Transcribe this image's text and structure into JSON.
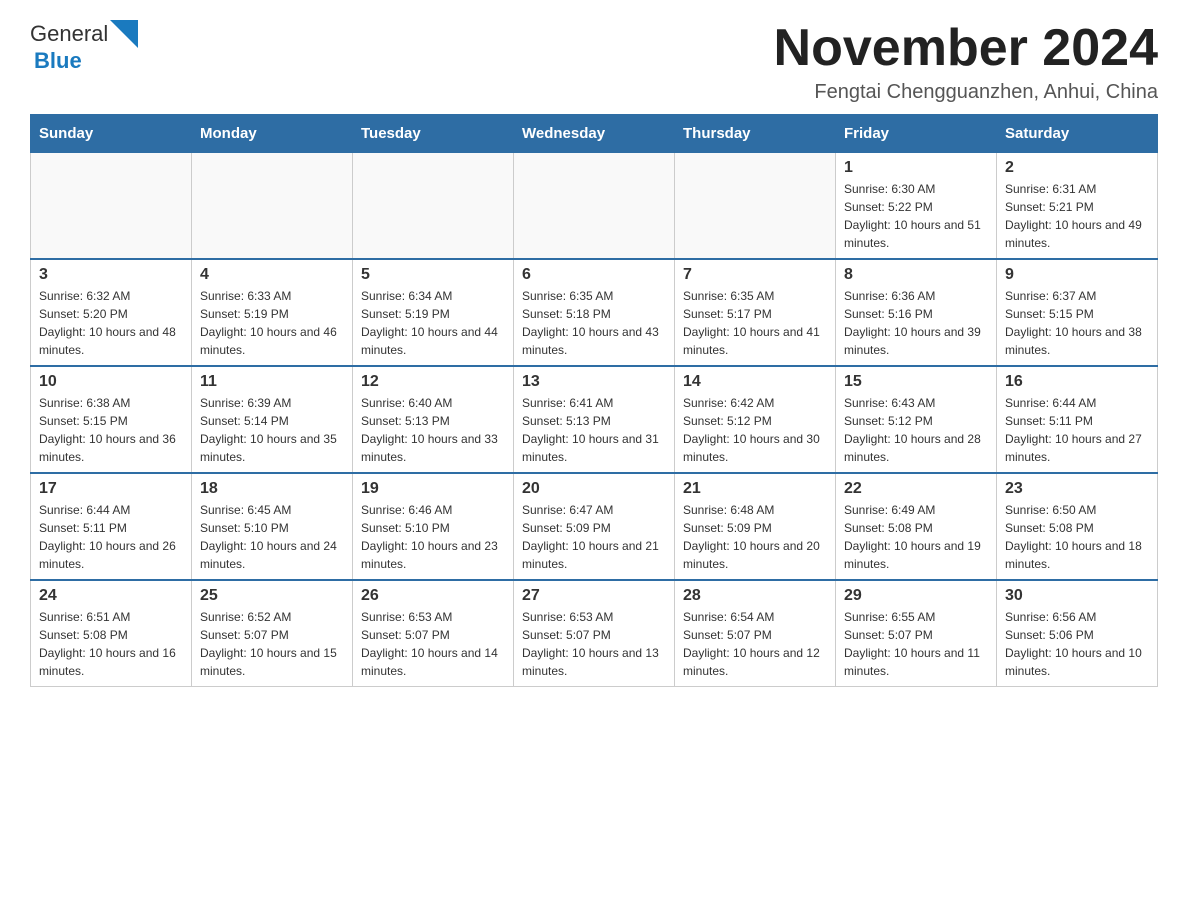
{
  "header": {
    "month_title": "November 2024",
    "location": "Fengtai Chengguanzhen, Anhui, China",
    "logo_general": "General",
    "logo_blue": "Blue"
  },
  "weekdays": [
    "Sunday",
    "Monday",
    "Tuesday",
    "Wednesday",
    "Thursday",
    "Friday",
    "Saturday"
  ],
  "weeks": [
    [
      {
        "day": "",
        "info": ""
      },
      {
        "day": "",
        "info": ""
      },
      {
        "day": "",
        "info": ""
      },
      {
        "day": "",
        "info": ""
      },
      {
        "day": "",
        "info": ""
      },
      {
        "day": "1",
        "info": "Sunrise: 6:30 AM\nSunset: 5:22 PM\nDaylight: 10 hours and 51 minutes."
      },
      {
        "day": "2",
        "info": "Sunrise: 6:31 AM\nSunset: 5:21 PM\nDaylight: 10 hours and 49 minutes."
      }
    ],
    [
      {
        "day": "3",
        "info": "Sunrise: 6:32 AM\nSunset: 5:20 PM\nDaylight: 10 hours and 48 minutes."
      },
      {
        "day": "4",
        "info": "Sunrise: 6:33 AM\nSunset: 5:19 PM\nDaylight: 10 hours and 46 minutes."
      },
      {
        "day": "5",
        "info": "Sunrise: 6:34 AM\nSunset: 5:19 PM\nDaylight: 10 hours and 44 minutes."
      },
      {
        "day": "6",
        "info": "Sunrise: 6:35 AM\nSunset: 5:18 PM\nDaylight: 10 hours and 43 minutes."
      },
      {
        "day": "7",
        "info": "Sunrise: 6:35 AM\nSunset: 5:17 PM\nDaylight: 10 hours and 41 minutes."
      },
      {
        "day": "8",
        "info": "Sunrise: 6:36 AM\nSunset: 5:16 PM\nDaylight: 10 hours and 39 minutes."
      },
      {
        "day": "9",
        "info": "Sunrise: 6:37 AM\nSunset: 5:15 PM\nDaylight: 10 hours and 38 minutes."
      }
    ],
    [
      {
        "day": "10",
        "info": "Sunrise: 6:38 AM\nSunset: 5:15 PM\nDaylight: 10 hours and 36 minutes."
      },
      {
        "day": "11",
        "info": "Sunrise: 6:39 AM\nSunset: 5:14 PM\nDaylight: 10 hours and 35 minutes."
      },
      {
        "day": "12",
        "info": "Sunrise: 6:40 AM\nSunset: 5:13 PM\nDaylight: 10 hours and 33 minutes."
      },
      {
        "day": "13",
        "info": "Sunrise: 6:41 AM\nSunset: 5:13 PM\nDaylight: 10 hours and 31 minutes."
      },
      {
        "day": "14",
        "info": "Sunrise: 6:42 AM\nSunset: 5:12 PM\nDaylight: 10 hours and 30 minutes."
      },
      {
        "day": "15",
        "info": "Sunrise: 6:43 AM\nSunset: 5:12 PM\nDaylight: 10 hours and 28 minutes."
      },
      {
        "day": "16",
        "info": "Sunrise: 6:44 AM\nSunset: 5:11 PM\nDaylight: 10 hours and 27 minutes."
      }
    ],
    [
      {
        "day": "17",
        "info": "Sunrise: 6:44 AM\nSunset: 5:11 PM\nDaylight: 10 hours and 26 minutes."
      },
      {
        "day": "18",
        "info": "Sunrise: 6:45 AM\nSunset: 5:10 PM\nDaylight: 10 hours and 24 minutes."
      },
      {
        "day": "19",
        "info": "Sunrise: 6:46 AM\nSunset: 5:10 PM\nDaylight: 10 hours and 23 minutes."
      },
      {
        "day": "20",
        "info": "Sunrise: 6:47 AM\nSunset: 5:09 PM\nDaylight: 10 hours and 21 minutes."
      },
      {
        "day": "21",
        "info": "Sunrise: 6:48 AM\nSunset: 5:09 PM\nDaylight: 10 hours and 20 minutes."
      },
      {
        "day": "22",
        "info": "Sunrise: 6:49 AM\nSunset: 5:08 PM\nDaylight: 10 hours and 19 minutes."
      },
      {
        "day": "23",
        "info": "Sunrise: 6:50 AM\nSunset: 5:08 PM\nDaylight: 10 hours and 18 minutes."
      }
    ],
    [
      {
        "day": "24",
        "info": "Sunrise: 6:51 AM\nSunset: 5:08 PM\nDaylight: 10 hours and 16 minutes."
      },
      {
        "day": "25",
        "info": "Sunrise: 6:52 AM\nSunset: 5:07 PM\nDaylight: 10 hours and 15 minutes."
      },
      {
        "day": "26",
        "info": "Sunrise: 6:53 AM\nSunset: 5:07 PM\nDaylight: 10 hours and 14 minutes."
      },
      {
        "day": "27",
        "info": "Sunrise: 6:53 AM\nSunset: 5:07 PM\nDaylight: 10 hours and 13 minutes."
      },
      {
        "day": "28",
        "info": "Sunrise: 6:54 AM\nSunset: 5:07 PM\nDaylight: 10 hours and 12 minutes."
      },
      {
        "day": "29",
        "info": "Sunrise: 6:55 AM\nSunset: 5:07 PM\nDaylight: 10 hours and 11 minutes."
      },
      {
        "day": "30",
        "info": "Sunrise: 6:56 AM\nSunset: 5:06 PM\nDaylight: 10 hours and 10 minutes."
      }
    ]
  ]
}
